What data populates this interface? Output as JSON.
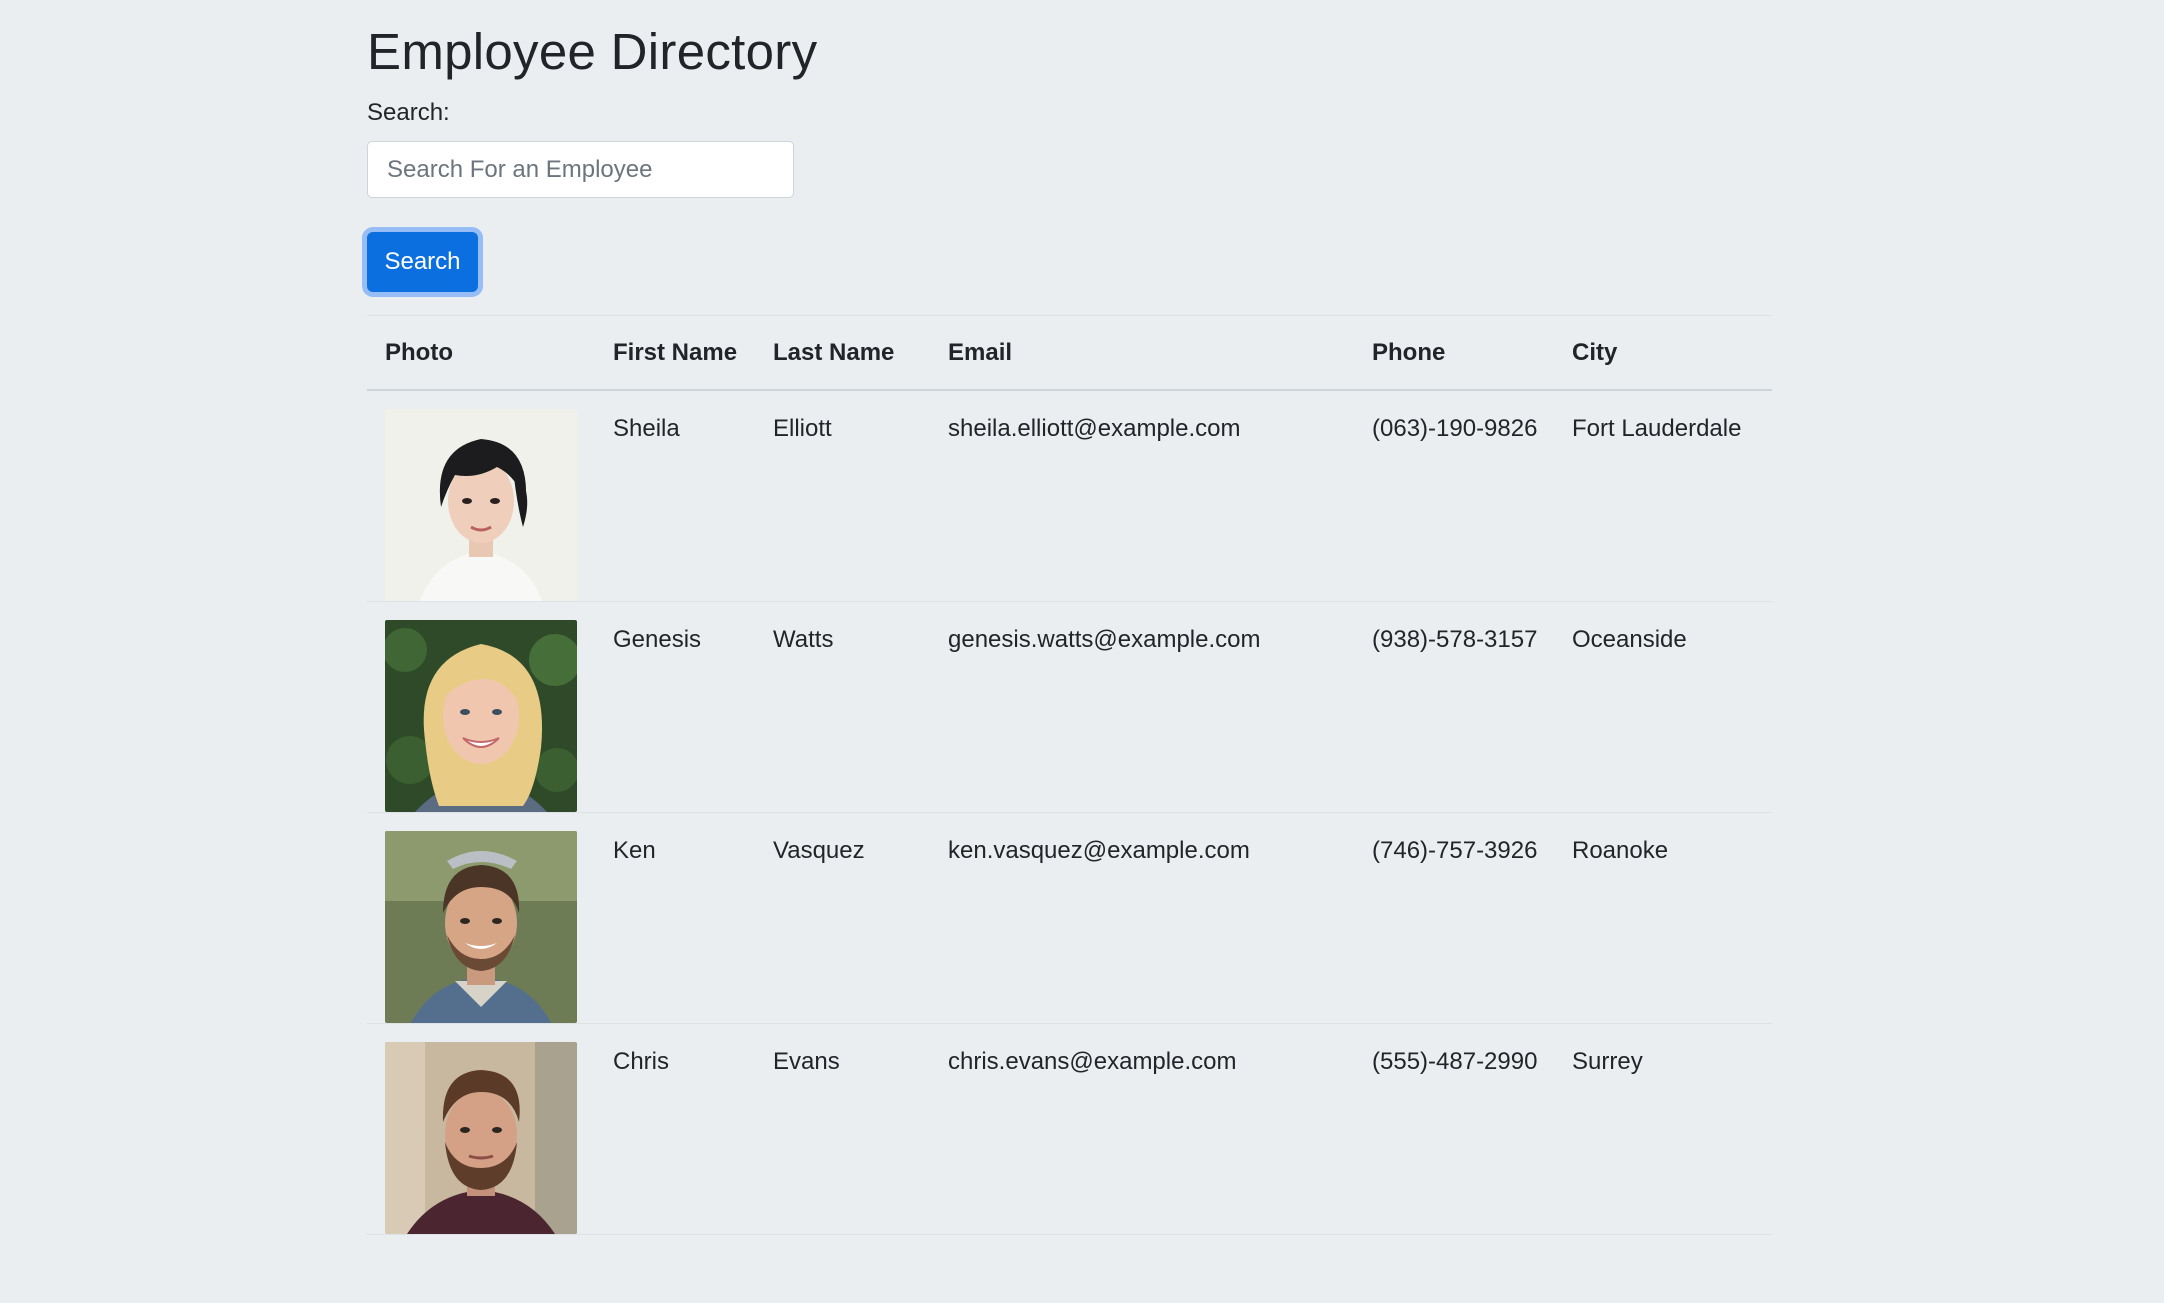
{
  "header": {
    "title": "Employee Directory"
  },
  "search": {
    "label": "Search:",
    "placeholder": "Search For an Employee",
    "value": "",
    "button_label": "Search"
  },
  "table": {
    "columns": [
      "Photo",
      "First Name",
      "Last Name",
      "Email",
      "Phone",
      "City"
    ],
    "rows": [
      {
        "first_name": "Sheila",
        "last_name": "Elliott",
        "email": "sheila.elliott@example.com",
        "phone": "(063)-190-9826",
        "city": "Fort Lauderdale",
        "photo": "employee-photo"
      },
      {
        "first_name": "Genesis",
        "last_name": "Watts",
        "email": "genesis.watts@example.com",
        "phone": "(938)-578-3157",
        "city": "Oceanside",
        "photo": "employee-photo"
      },
      {
        "first_name": "Ken",
        "last_name": "Vasquez",
        "email": "ken.vasquez@example.com",
        "phone": "(746)-757-3926",
        "city": "Roanoke",
        "photo": "employee-photo"
      },
      {
        "first_name": "Chris",
        "last_name": "Evans",
        "email": "chris.evans@example.com",
        "phone": "(555)-487-2990",
        "city": "Surrey",
        "photo": "employee-photo"
      }
    ]
  },
  "colors": {
    "page_background": "#ebeef1",
    "primary_button": "#0b6fdf",
    "text": "#212529"
  }
}
